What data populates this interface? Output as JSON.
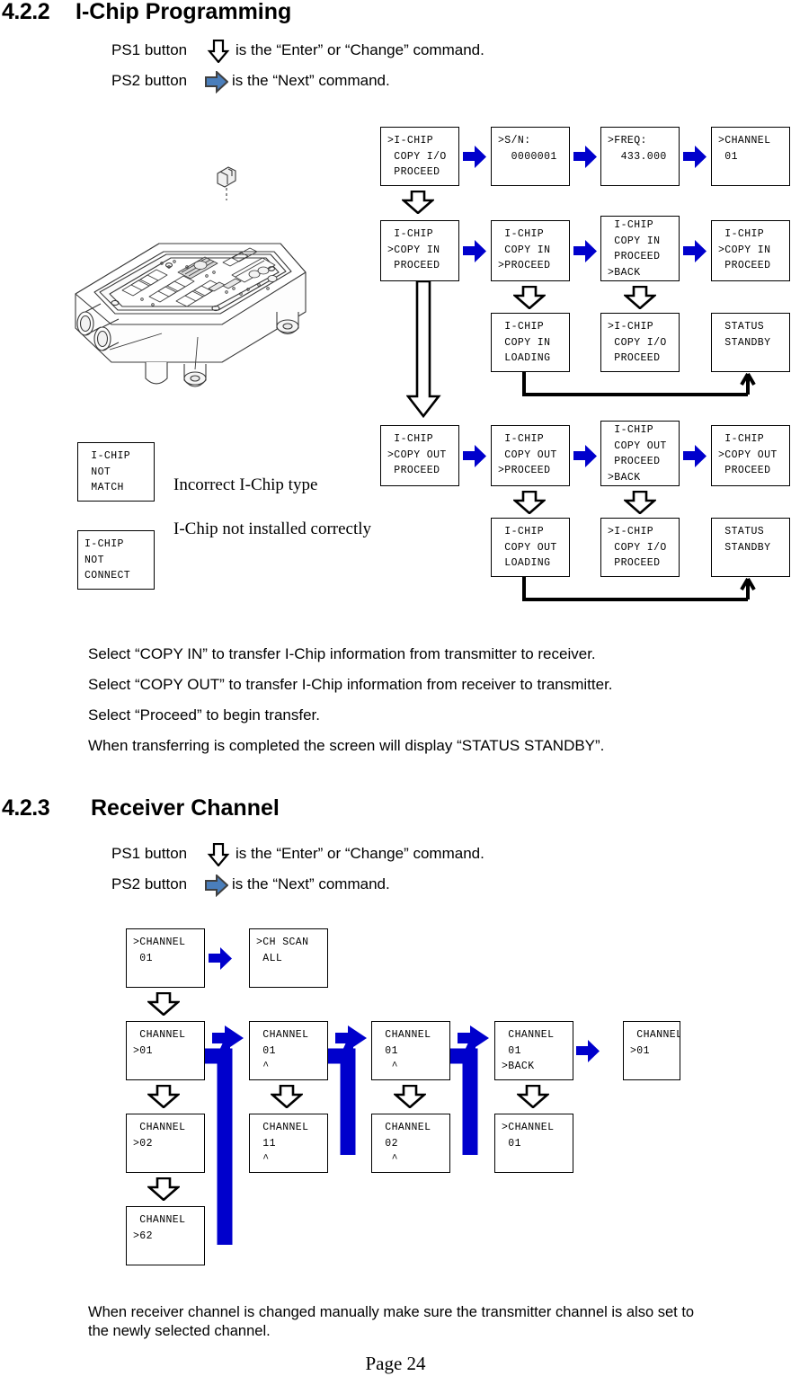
{
  "page": {
    "number_label": "Page 24"
  },
  "sections": [
    {
      "number": "4.2.2",
      "title": "I-Chip Programming",
      "ps1_pre": "PS1 button",
      "ps1_post": "is the “Enter” or “Change” command.",
      "ps2_pre": "PS2 button",
      "ps2_post": "is the “Next” command."
    },
    {
      "number": "4.2.3",
      "title": "Receiver Channel",
      "ps1_pre": "PS1 button",
      "ps1_post": "is the “Enter” or “Change” command.",
      "ps2_pre": "PS2 button",
      "ps2_post": "is the “Next” command."
    }
  ],
  "ichip_diagram": {
    "row1": [
      {
        "lines": [
          ">I-CHIP",
          " COPY I/O",
          " PROCEED"
        ]
      },
      {
        "lines": [
          ">S/N:",
          "  0000001"
        ]
      },
      {
        "lines": [
          ">FREQ:",
          "  433.000"
        ]
      },
      {
        "lines": [
          ">CHANNEL",
          " 01"
        ]
      }
    ],
    "row2": [
      {
        "lines": [
          " I-CHIP",
          ">COPY IN",
          " PROCEED"
        ]
      },
      {
        "lines": [
          " I-CHIP",
          " COPY IN",
          ">PROCEED"
        ]
      },
      {
        "lines": [
          " I-CHIP",
          " COPY IN",
          " PROCEED",
          ">BACK"
        ]
      },
      {
        "lines": [
          " I-CHIP",
          ">COPY IN",
          " PROCEED"
        ]
      }
    ],
    "row3": [
      {
        "lines": [
          " I-CHIP",
          " COPY IN",
          " LOADING"
        ]
      },
      {
        "lines": [
          ">I-CHIP",
          " COPY I/O",
          " PROCEED"
        ]
      },
      {
        "lines": [
          " STATUS",
          " STANDBY"
        ]
      }
    ],
    "row4": [
      {
        "lines": [
          " I-CHIP",
          ">COPY OUT",
          " PROCEED"
        ]
      },
      {
        "lines": [
          " I-CHIP",
          " COPY OUT",
          ">PROCEED"
        ]
      },
      {
        "lines": [
          " I-CHIP",
          " COPY OUT",
          " PROCEED",
          ">BACK"
        ]
      },
      {
        "lines": [
          " I-CHIP",
          ">COPY OUT",
          " PROCEED"
        ]
      }
    ],
    "row5": [
      {
        "lines": [
          " I-CHIP",
          " COPY OUT",
          " LOADING"
        ]
      },
      {
        "lines": [
          ">I-CHIP",
          " COPY I/O",
          " PROCEED"
        ]
      },
      {
        "lines": [
          " STATUS",
          " STANDBY"
        ]
      }
    ],
    "errors": [
      {
        "lines": [
          " I-CHIP",
          " NOT",
          " MATCH"
        ],
        "caption": "Incorrect I-Chip type"
      },
      {
        "lines": [
          "I-CHIP",
          "NOT",
          "CONNECT"
        ],
        "caption": "I-Chip not installed correctly"
      }
    ]
  },
  "ichip_notes": [
    "Select “COPY IN” to transfer I-Chip information from transmitter to receiver.",
    "Select “COPY OUT” to transfer I-Chip information from receiver to transmitter.",
    "Select “Proceed” to begin transfer.",
    "When transferring is completed the screen will display “STATUS STANDBY”."
  ],
  "channel_diagram": {
    "row1": [
      {
        "lines": [
          ">CHANNEL",
          " 01"
        ]
      },
      {
        "lines": [
          ">CH SCAN",
          " ALL"
        ]
      }
    ],
    "row2": [
      {
        "lines": [
          " CHANNEL",
          ">01"
        ]
      },
      {
        "lines": [
          " CHANNEL",
          " 01",
          " ^"
        ]
      },
      {
        "lines": [
          " CHANNEL",
          " 01",
          "  ^"
        ]
      },
      {
        "lines": [
          " CHANNEL",
          " 01",
          ">BACK"
        ]
      },
      {
        "lines": [
          " CHANNEL",
          ">01"
        ]
      }
    ],
    "row3": [
      {
        "lines": [
          " CHANNEL",
          ">02"
        ]
      },
      {
        "lines": [
          " CHANNEL",
          " 11",
          " ^"
        ]
      },
      {
        "lines": [
          " CHANNEL",
          " 02",
          "  ^"
        ]
      },
      {
        "lines": [
          ">CHANNEL",
          " 01"
        ]
      }
    ],
    "row4": [
      {
        "lines": [
          " CHANNEL",
          ">62"
        ]
      }
    ]
  },
  "channel_note": "When receiver channel is changed manually make sure the transmitter channel is also set to the newly selected channel.",
  "colors": {
    "arrow_blue": "#0000CC",
    "arrow_blue_light": "#4A7EBB",
    "outline": "#000000"
  }
}
